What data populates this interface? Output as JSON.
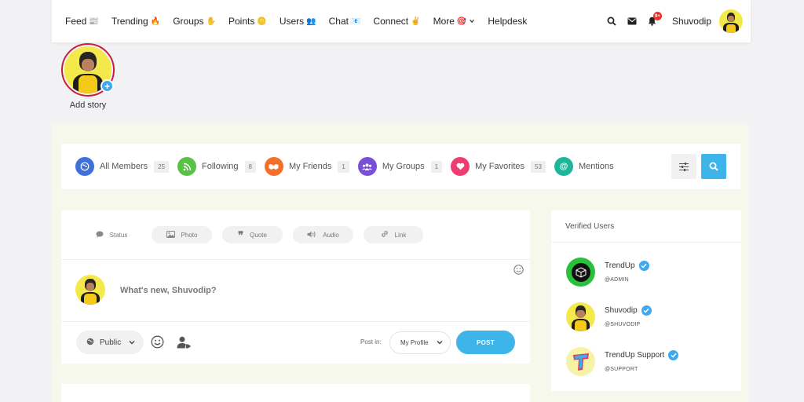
{
  "nav": {
    "items": [
      {
        "label": "Feed",
        "emoji": "📰"
      },
      {
        "label": "Trending",
        "emoji": "🔥"
      },
      {
        "label": "Groups",
        "emoji": "✋"
      },
      {
        "label": "Points",
        "emoji": "🪙"
      },
      {
        "label": "Users",
        "emoji": "👥"
      },
      {
        "label": "Chat",
        "emoji": "📧"
      },
      {
        "label": "Connect",
        "emoji": "✌"
      },
      {
        "label": "More",
        "emoji": "🎯"
      },
      {
        "label": "Helpdesk",
        "emoji": ""
      }
    ],
    "notification_count": "9+",
    "user_name": "Shuvodip"
  },
  "story": {
    "label": "Add story",
    "plus": "+"
  },
  "filters": [
    {
      "label": "All Members",
      "count": "25",
      "color": "#3f6fd8"
    },
    {
      "label": "Following",
      "count": "8",
      "color": "#57c246"
    },
    {
      "label": "My Friends",
      "count": "1",
      "color": "#f3702b"
    },
    {
      "label": "My Groups",
      "count": "1",
      "color": "#7a4ed8"
    },
    {
      "label": "My Favorites",
      "count": "53",
      "color": "#ef3c71"
    },
    {
      "label": "Mentions",
      "count": "",
      "color": "#1fb59a"
    }
  ],
  "composer": {
    "tabs": [
      "Status",
      "Photo",
      "Quote",
      "Audio",
      "Link"
    ],
    "placeholder": "What's new, Shuvodip?",
    "privacy": "Public",
    "post_in_label": "Post in:",
    "post_in_value": "My Profile",
    "post_button": "POST"
  },
  "verified": {
    "title": "Verified Users",
    "users": [
      {
        "name": "TrendUp",
        "handle": "@ADMIN"
      },
      {
        "name": "Shuvodip",
        "handle": "@SHUVODIP"
      },
      {
        "name": "TrendUp Support",
        "handle": "@SUPPORT"
      }
    ]
  },
  "colors": {
    "accent": "#3db5ea",
    "story_ring": "#c71f3a",
    "badge": "#e5322d"
  }
}
